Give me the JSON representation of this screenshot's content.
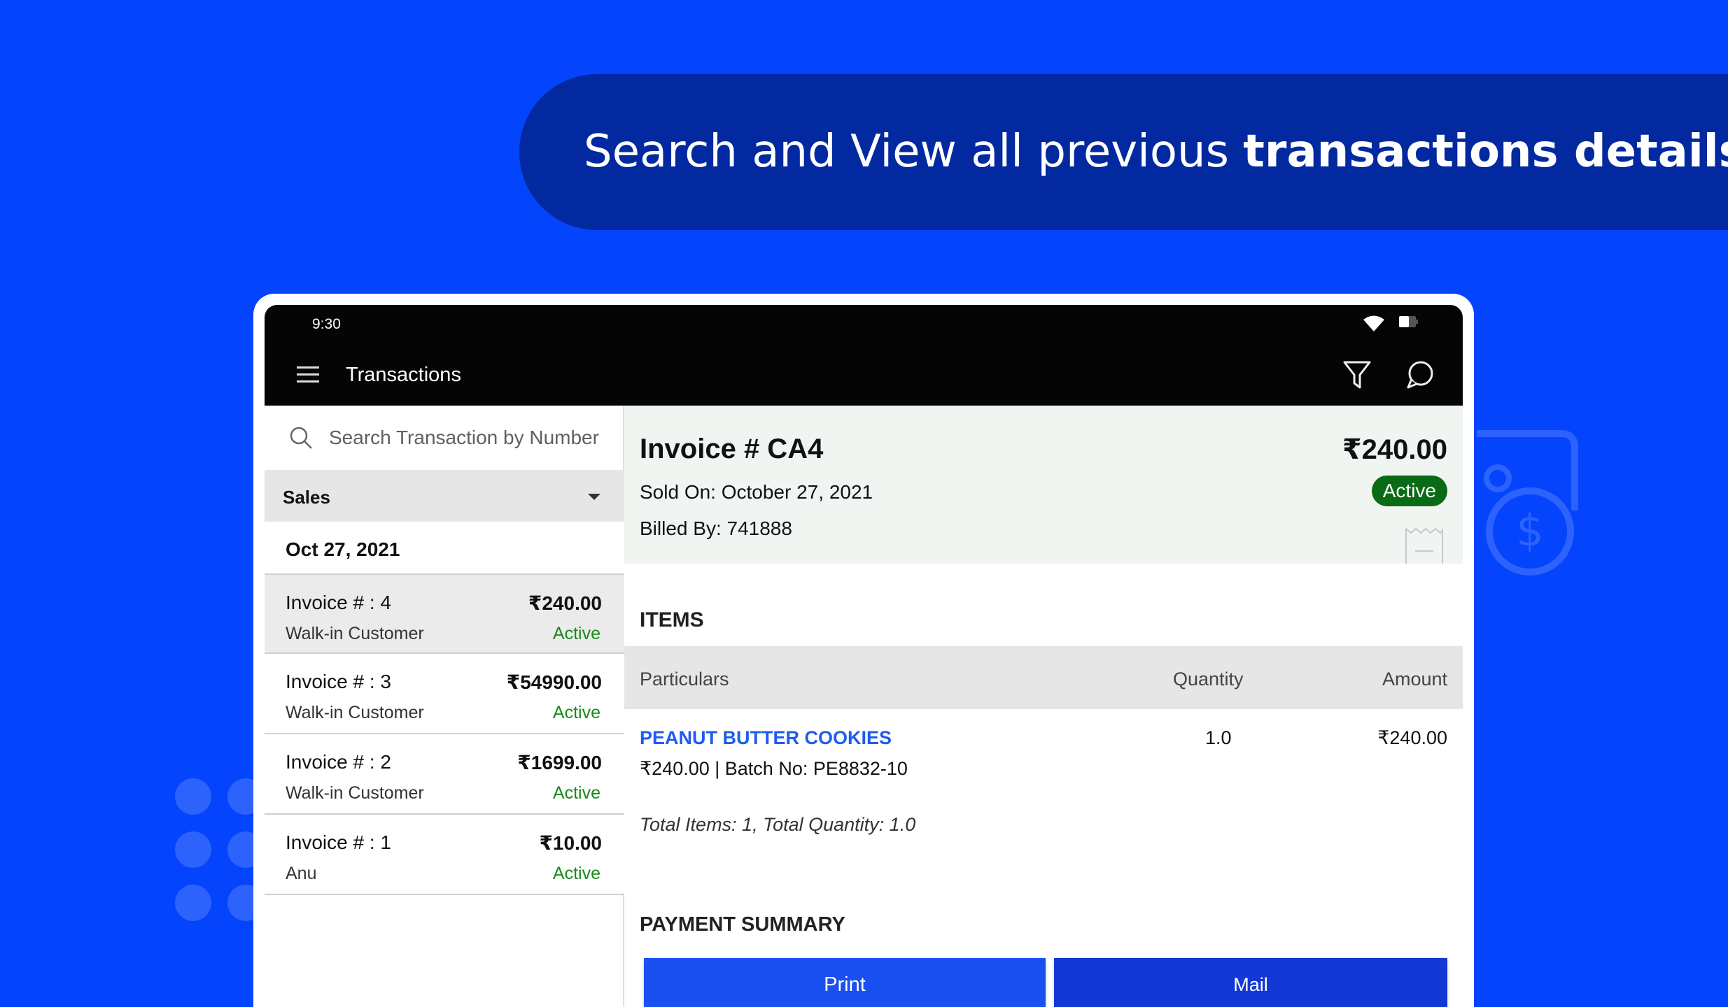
{
  "headline": {
    "prefix": "Search and View all previous ",
    "bold": "transactions details"
  },
  "status_bar": {
    "time": "9:30"
  },
  "app_bar": {
    "title": "Transactions"
  },
  "search": {
    "placeholder": "Search Transaction by Number"
  },
  "filter": {
    "selected": "Sales"
  },
  "date_group": "Oct 27, 2021",
  "transactions": [
    {
      "number": "Invoice # : 4",
      "amount": "₹240.00",
      "customer": "Walk-in Customer",
      "status": "Active"
    },
    {
      "number": "Invoice # : 3",
      "amount": "₹54990.00",
      "customer": "Walk-in Customer",
      "status": "Active"
    },
    {
      "number": "Invoice # : 2",
      "amount": "₹1699.00",
      "customer": "Walk-in Customer",
      "status": "Active"
    },
    {
      "number": "Invoice # : 1",
      "amount": "₹10.00",
      "customer": "Anu",
      "status": "Active"
    }
  ],
  "invoice": {
    "title": "Invoice #  CA4",
    "total": "₹240.00",
    "sold_on": "Sold On: October 27, 2021",
    "billed_by": "Billed By: 741888",
    "status": "Active"
  },
  "items": {
    "heading": "ITEMS",
    "columns": {
      "particulars": "Particulars",
      "quantity": "Quantity",
      "amount": "Amount"
    },
    "rows": [
      {
        "name": "PEANUT BUTTER COOKIES",
        "quantity": "1.0",
        "amount": "₹240.00",
        "detail": "₹240.00  |  Batch No: PE8832-10"
      }
    ],
    "totals": "Total Items: 1, Total Quantity: 1.0"
  },
  "payment": {
    "heading": "PAYMENT SUMMARY",
    "print_label": "Print",
    "mail_label": "Mail"
  },
  "colors": {
    "background": "#0444fc",
    "pill": "#0229a0",
    "app_bar": "#050505",
    "active_green": "#1a8a1a",
    "badge_green": "#0a6b16",
    "link_blue": "#1e5cf0",
    "print_button": "#1a4ff0",
    "mail_button": "#1238d6"
  }
}
